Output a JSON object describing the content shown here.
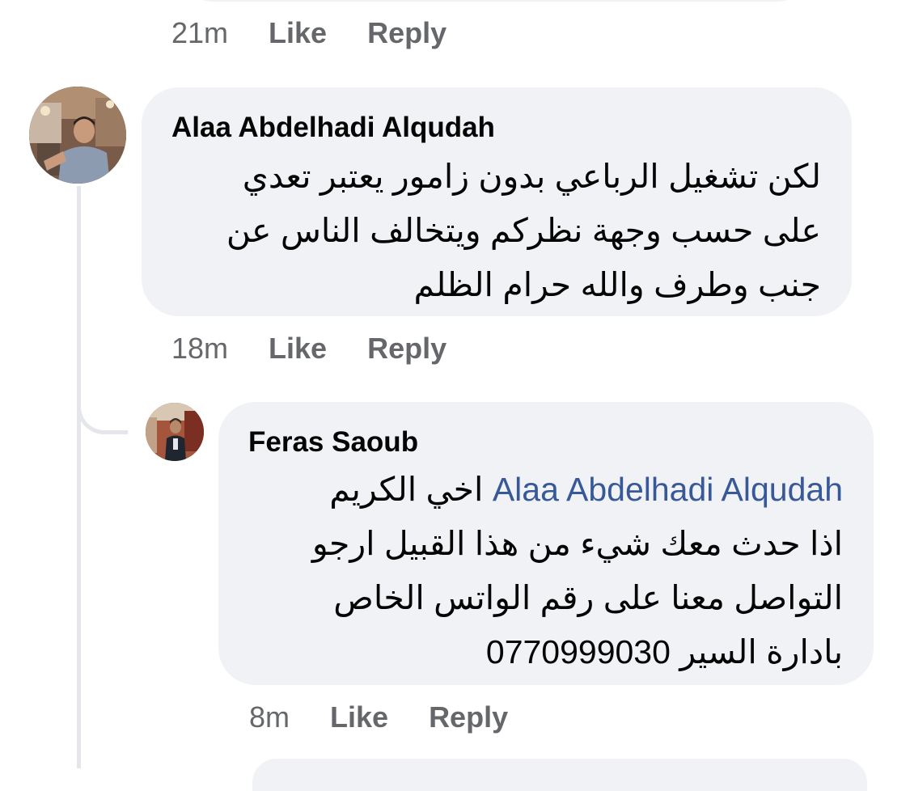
{
  "previous_comment": {
    "time": "21m",
    "like_label": "Like",
    "reply_label": "Reply"
  },
  "comment": {
    "author": "Alaa Abdelhadi Alqudah",
    "lines": [
      "لكن تشغيل الرباعي بدون زامور يعتبر تعدي",
      "على حسب وجهة نظركم ويتخالف الناس عن",
      "جنب وطرف والله حرام الظلم"
    ],
    "time": "18m",
    "like_label": "Like",
    "reply_label": "Reply"
  },
  "reply": {
    "author": "Feras Saoub",
    "mention": "Alaa Abdelhadi Alqudah",
    "first_line_text": "اخي الكريم",
    "lines": [
      "اذا حدث معك شيء من هذا القبيل ارجو",
      "التواصل معنا على رقم الواتس الخاص",
      "بادارة السير 0770999030"
    ],
    "time": "8m",
    "like_label": "Like",
    "reply_label": "Reply"
  },
  "colors": {
    "bubble": "#f0f2f5",
    "meta_text": "#65676b",
    "mention": "#385898",
    "thread_line": "#e4e6eb"
  }
}
